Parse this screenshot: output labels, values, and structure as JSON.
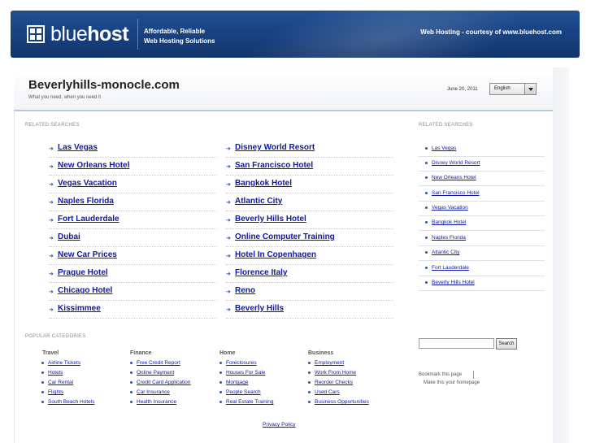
{
  "header": {
    "logo_text_light": "blue",
    "logo_text_bold": "host",
    "tagline_line1": "Affordable, Reliable",
    "tagline_line2": "Web Hosting Solutions",
    "courtesy": "Web Hosting - courtesy of www.bluehost.com"
  },
  "site": {
    "title": "Beverlyhills-monocle.com",
    "subtitle": "What you need, when you need it",
    "date": "June 20, 2011",
    "language": "English"
  },
  "related_searches": {
    "label": "RELATED SEARCHES",
    "left": [
      "Las Vegas",
      "New Orleans Hotel",
      "Vegas Vacation",
      "Naples Florida",
      "Fort Lauderdale",
      "Dubai",
      "New Car Prices",
      "Prague Hotel",
      "Chicago Hotel",
      "Kissimmee"
    ],
    "right": [
      "Disney World Resort",
      "San Francisco Hotel",
      "Bangkok Hotel",
      "Atlantic City",
      "Beverly Hills Hotel",
      "Online Computer Training",
      "Hotel In Copenhagen",
      "Florence Italy",
      "Reno",
      "Beverly Hills"
    ]
  },
  "sidebar": {
    "label": "RELATED SEARCHES",
    "items": [
      "Las Vegas",
      "Disney World Resort",
      "New Orleans Hotel",
      "San Francisco Hotel",
      "Vegas Vacation",
      "Bangkok Hotel",
      "Naples Florida",
      "Atlantic City",
      "Fort Lauderdale",
      "Beverly Hills Hotel"
    ],
    "search_button": "Search",
    "bookmark": "Bookmark this page",
    "homepage": "Make this your homepage"
  },
  "popular": {
    "label": "POPULAR CATEGORIES",
    "categories": [
      {
        "title": "Travel",
        "items": [
          "Airline Tickets",
          "Hotels",
          "Car Rental",
          "Flights",
          "South Beach Hotels"
        ]
      },
      {
        "title": "Finance",
        "items": [
          "Free Credit Report",
          "Online Payment",
          "Credit Card Application",
          "Car Insurance",
          "Health Insurance"
        ]
      },
      {
        "title": "Home",
        "items": [
          "Foreclosures",
          "Houses For Sale",
          "Mortgage",
          "People Search",
          "Real Estate Training"
        ]
      },
      {
        "title": "Business",
        "items": [
          "Employment",
          "Work From Home",
          "Reorder Checks",
          "Used Cars",
          "Business Opportunities"
        ]
      }
    ]
  },
  "footer": {
    "privacy": "Privacy Policy"
  },
  "colors": {
    "banner": "#1a468a",
    "link": "#0c18a8",
    "accent": "#2a58a8"
  }
}
